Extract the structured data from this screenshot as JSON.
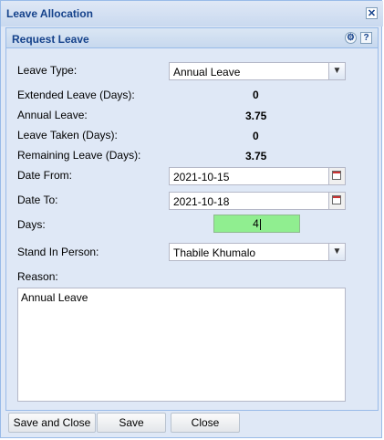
{
  "window": {
    "title": "Leave Allocation",
    "close_icon": "close-icon"
  },
  "panel": {
    "title": "Request Leave",
    "tools": [
      "gear-icon",
      "help-icon"
    ]
  },
  "form": {
    "leave_type_label": "Leave Type:",
    "leave_type_value": "Annual Leave",
    "extended_leave_label": "Extended Leave (Days):",
    "extended_leave_value": "0",
    "annual_leave_label": "Annual Leave:",
    "annual_leave_value": "3.75",
    "leave_taken_label": "Leave Taken (Days):",
    "leave_taken_value": "0",
    "remaining_leave_label": "Remaining Leave (Days):",
    "remaining_leave_value": "3.75",
    "date_from_label": "Date From:",
    "date_from_value": "2021-10-15",
    "date_to_label": "Date To:",
    "date_to_value": "2021-10-18",
    "days_label": "Days:",
    "days_value": "4",
    "stand_in_label": "Stand In Person:",
    "stand_in_value": "Thabile Khumalo",
    "reason_label": "Reason:",
    "reason_value": "Annual Leave"
  },
  "buttons": {
    "save_and_close": "Save and Close",
    "save": "Save",
    "close": "Close"
  },
  "colors": {
    "accent": "#15428b",
    "days_highlight": "#90ee90"
  }
}
